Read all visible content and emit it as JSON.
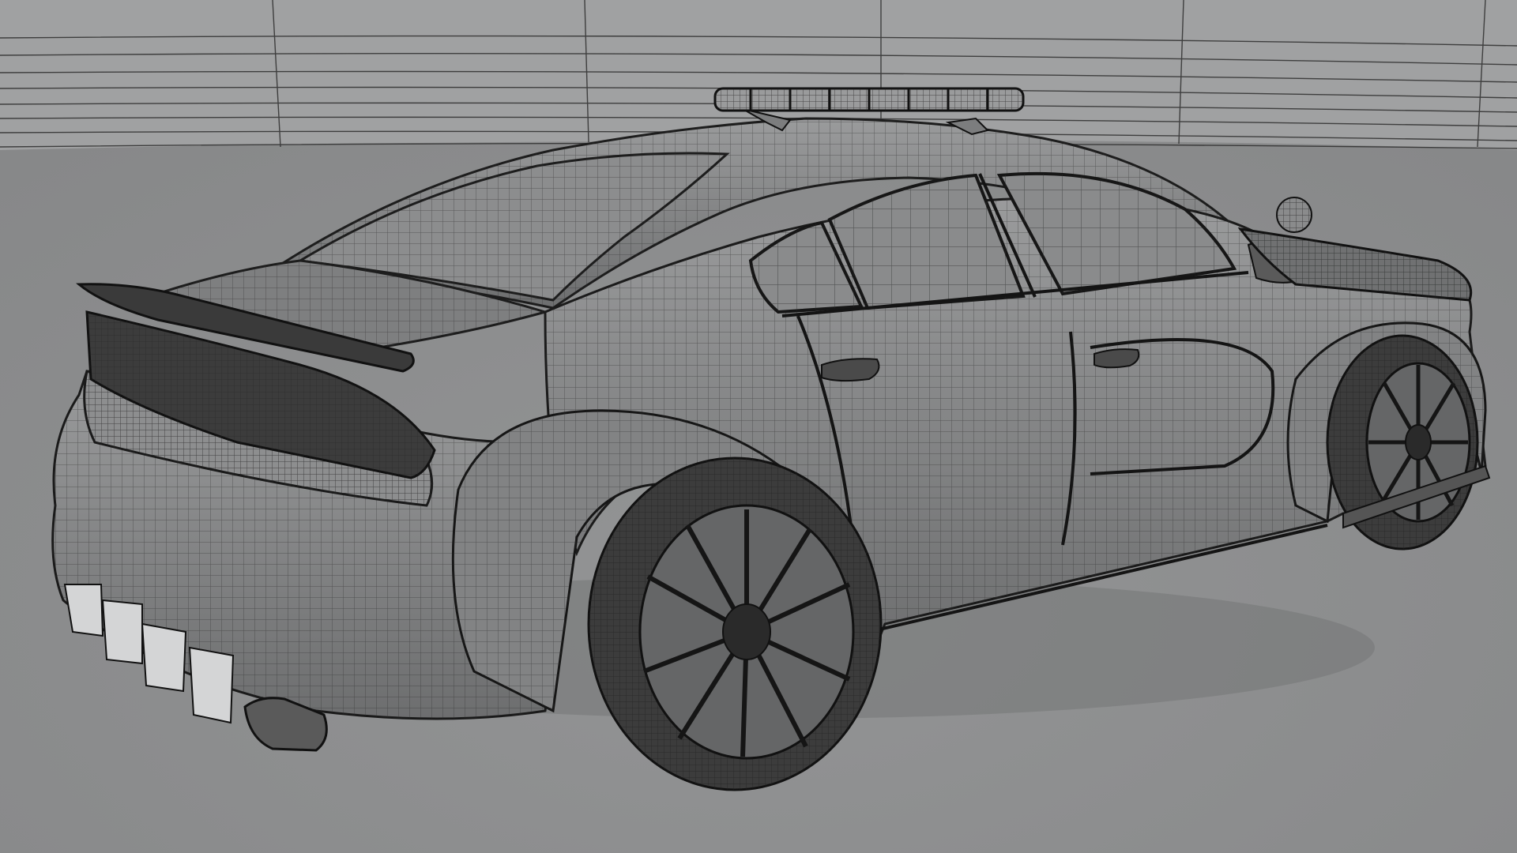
{
  "scene": {
    "subject": "police-sedan-wireframe-render",
    "colors": {
      "floor": "#8f9091",
      "backdrop": "#a3a4a5",
      "body": "#7b7c7d",
      "mesh_line": "#2a2a2a",
      "glass": "#8a8b8c",
      "tire": "#3b3b3b",
      "rim": "#5d5d5d",
      "light_bar": "#9a9b9c"
    }
  }
}
